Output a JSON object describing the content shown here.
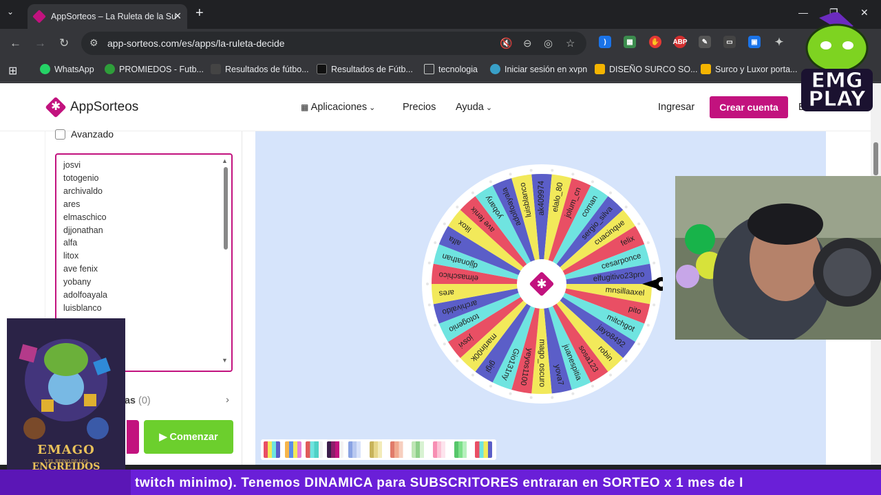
{
  "browser": {
    "tab_title": "AppSorteos – La Ruleta de la Su",
    "url": "app-sorteos.com/es/apps/la-ruleta-decide",
    "bookmarks": [
      {
        "label": "WhatsApp",
        "color": "#25d366"
      },
      {
        "label": "PROMIEDOS - Futb...",
        "color": "#2e9e3a"
      },
      {
        "label": "Resultados de fútbo...",
        "color": "#444"
      },
      {
        "label": "Resultados de Fútb...",
        "color": "#222"
      },
      {
        "label": "tecnologia",
        "color": "folder"
      },
      {
        "label": "Iniciar sesión en xvpn",
        "color": "#39a0c8"
      },
      {
        "label": "DISEÑO SURCO SO...",
        "color": "#f4b400"
      },
      {
        "label": "Surco y Luxor porta...",
        "color": "#f4b400"
      }
    ],
    "extensions": [
      "ABP"
    ]
  },
  "header": {
    "logo": "AppSorteos",
    "nav": {
      "apps": "Aplicaciones",
      "prices": "Precios",
      "help": "Ayuda"
    },
    "login": "Ingresar",
    "create_account": "Crear cuenta",
    "language": "ES"
  },
  "left_panel": {
    "advanced_label": "Avanzado",
    "entries": [
      "josvi",
      "totogenio",
      "archivaldo",
      "ares",
      "elmaschico",
      "djjonathan",
      "alfa",
      "litox",
      "ave fenix",
      "yobany",
      "adolfoayala",
      "luisblanco"
    ],
    "results_label": "tas",
    "results_count": "(0)",
    "start_button": "Comenzar"
  },
  "wheel": {
    "segments": [
      "ak409974",
      "elalo_80",
      "jolum_cn",
      "coman",
      "sergio_silva",
      "cuacinque",
      "felix",
      "cesarponce",
      "elfugitivo23pro",
      "mnsillaaxel",
      "pito",
      "mitchgot",
      "jayo8492",
      "robin",
      "sosa123",
      "juanespitia",
      "yova7",
      "mago_oscuro",
      "yeyos1100",
      "Gio131ny",
      "gigi",
      "martin00k",
      "josvi",
      "totogenio",
      "archivaldo",
      "ares",
      "elmaschico",
      "djjonathan",
      "alfa",
      "litox",
      "ave fenix",
      "yobany",
      "adolfoayala",
      "luisblanco"
    ],
    "colors": [
      "#5b5ec8",
      "#f2e95a",
      "#e94f64",
      "#6fe4e0"
    ]
  },
  "palette": [
    [
      "#e94f64",
      "#f2e95a",
      "#6fe4e0",
      "#5b5ec8"
    ],
    [
      "#f6b54b",
      "#5b8ee8",
      "#f2e95a",
      "#e67fd8"
    ],
    [
      "#e05a5a",
      "#6fe4e0",
      "#4fd1c5",
      "#f3f3f3"
    ],
    [
      "#3b1d4a",
      "#8e1d6b",
      "#c2127e",
      "#f3f3f3"
    ],
    [
      "#8aa3e3",
      "#b8c8f0",
      "#d8e2fa",
      "#ffffff"
    ],
    [
      "#c7b35a",
      "#e6d68a",
      "#f3ebb8",
      "#ffffff"
    ],
    [
      "#e07b6a",
      "#f0a98f",
      "#f7cfbf",
      "#ffffff"
    ],
    [
      "#bfe6b5",
      "#8fd08a",
      "#d8f2d2",
      "#ffffff"
    ],
    [
      "#f78fb3",
      "#fbc4d6",
      "#fde4ed",
      "#ffffff"
    ],
    [
      "#56c66a",
      "#7ee08a",
      "#b6f0bd",
      "#ffffff"
    ],
    [
      "#e94f64",
      "#6fe4e0",
      "#f2e95a",
      "#5b5ec8"
    ]
  ],
  "overlay": {
    "poster_title": "EMAGO",
    "poster_subtitle": "Y EL REINO DE LOS",
    "poster_title2": "ENGREIDOS",
    "brand": "EMG PLAY",
    "ticker": "twitch minimo).       Tenemos DINAMICA para SUBSCRITORES entraran en SORTEO x 1 mes de I"
  }
}
